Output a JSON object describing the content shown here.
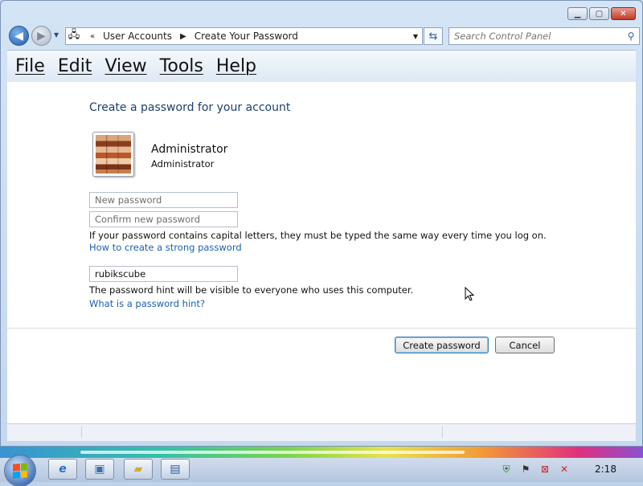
{
  "address_bar": {
    "chevron": "«",
    "breadcrumb": [
      "User Accounts",
      "Create Your Password"
    ]
  },
  "search": {
    "placeholder": "Search Control Panel"
  },
  "menu": [
    "File",
    "Edit",
    "View",
    "Tools",
    "Help"
  ],
  "page": {
    "heading": "Create a password for your account",
    "user": {
      "name": "Administrator",
      "role": "Administrator"
    },
    "new_password_placeholder": "New password",
    "confirm_password_placeholder": "Confirm new password",
    "caps_note": "If your password contains capital letters, they must be typed the same way every time you log on.",
    "strong_password_link": "How to create a strong password",
    "hint_value": "rubikscube",
    "hint_note": "The password hint will be visible to everyone who uses this computer.",
    "hint_link": "What is a password hint?"
  },
  "buttons": {
    "create": "Create password",
    "cancel": "Cancel"
  },
  "taskbar": {
    "clock": "2:18"
  },
  "icons": [
    "back-icon",
    "forward-icon",
    "control-panel-icon",
    "refresh-icon",
    "search-icon",
    "start-orb-icon",
    "internet-explorer-icon",
    "folder-icon",
    "network-icon",
    "flag-icon"
  ],
  "colors": {
    "link": "#1a5fb4",
    "heading": "#1e3f73",
    "accent": "#3c7fb1"
  }
}
